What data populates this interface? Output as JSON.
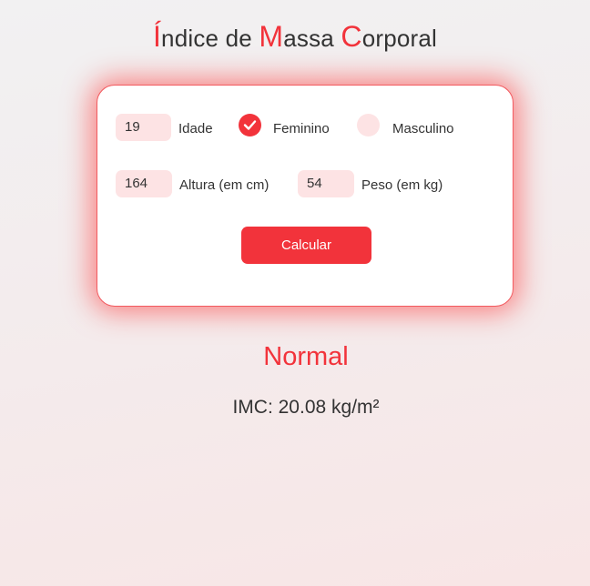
{
  "header": {
    "title_parts": [
      {
        "text": "Í",
        "accent": true
      },
      {
        "text": "ndice de ",
        "accent": false
      },
      {
        "text": "M",
        "accent": true
      },
      {
        "text": "assa ",
        "accent": false
      },
      {
        "text": "C",
        "accent": true
      },
      {
        "text": "orporal",
        "accent": false
      }
    ]
  },
  "form": {
    "age": {
      "value": "19",
      "label": "Idade"
    },
    "sex": {
      "options": [
        {
          "label": "Feminino",
          "checked": true
        },
        {
          "label": "Masculino",
          "checked": false
        }
      ]
    },
    "height": {
      "value": "164",
      "label": "Altura (em cm)"
    },
    "weight": {
      "value": "54",
      "label": "Peso (em kg)"
    },
    "submit_label": "Calcular"
  },
  "result": {
    "category": "Normal",
    "imc_text": "IMC: 20.08 kg/m²"
  },
  "colors": {
    "accent": "#f2333b",
    "field_bg": "#fde3e4",
    "text": "#333333"
  },
  "icons": {
    "checked_radio": "checkmark-icon"
  }
}
